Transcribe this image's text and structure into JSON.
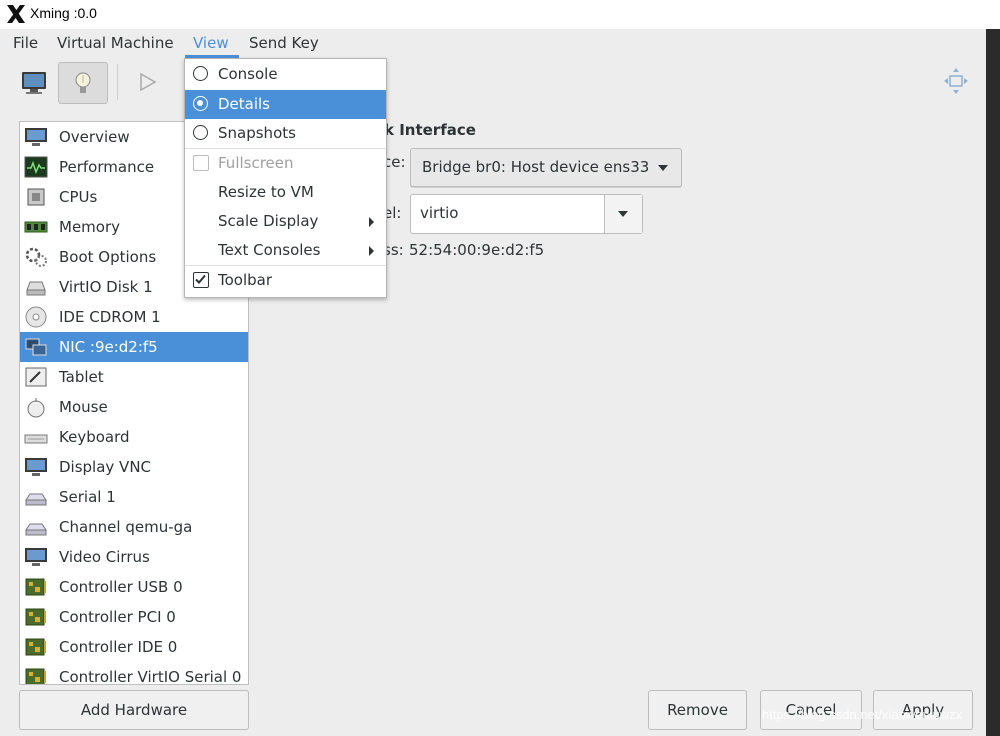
{
  "window": {
    "title": "Xming :0.0"
  },
  "menubar": {
    "file": "File",
    "virtual_machine": "Virtual Machine",
    "view": "View",
    "send_key": "Send Key"
  },
  "toolbar": {
    "buttons": [
      "monitor-icon",
      "lightbulb-icon",
      "play-icon",
      "fullscreen-move-icon"
    ],
    "selected": "lightbulb-icon"
  },
  "sidebar": {
    "items": [
      {
        "label": "Overview",
        "icon": "overview-monitor-icon"
      },
      {
        "label": "Performance",
        "icon": "performance-graph-icon"
      },
      {
        "label": "CPUs",
        "icon": "cpu-chip-icon"
      },
      {
        "label": "Memory",
        "icon": "memory-module-icon"
      },
      {
        "label": "Boot Options",
        "icon": "gears-icon"
      },
      {
        "label": "VirtIO Disk 1",
        "icon": "disk-drive-icon"
      },
      {
        "label": "IDE CDROM 1",
        "icon": "cdrom-icon"
      },
      {
        "label": "NIC :9e:d2:f5",
        "icon": "network-card-icon"
      },
      {
        "label": "Tablet",
        "icon": "tablet-icon"
      },
      {
        "label": "Mouse",
        "icon": "mouse-icon"
      },
      {
        "label": "Keyboard",
        "icon": "keyboard-icon"
      },
      {
        "label": "Display VNC",
        "icon": "display-icon"
      },
      {
        "label": "Serial 1",
        "icon": "serial-icon"
      },
      {
        "label": "Channel qemu-ga",
        "icon": "channel-icon"
      },
      {
        "label": "Video Cirrus",
        "icon": "video-icon"
      },
      {
        "label": "Controller USB 0",
        "icon": "controller-board-icon"
      },
      {
        "label": "Controller PCI 0",
        "icon": "controller-board-icon"
      },
      {
        "label": "Controller IDE 0",
        "icon": "controller-board-icon"
      },
      {
        "label": "Controller VirtIO Serial 0",
        "icon": "controller-board-icon"
      }
    ],
    "selected_index": 7
  },
  "details": {
    "heading_visible": "k Interface",
    "source_label_visible": "ce:",
    "source_value": "Bridge br0: Host device ens33",
    "model_label_visible": "el:",
    "model_value": "virtio",
    "mac_label_visible": "ss:",
    "mac_value": "52:54:00:9e:d2:f5"
  },
  "buttons": {
    "add_hardware": "Add Hardware",
    "remove": "Remove",
    "cancel": "Cancel",
    "apply": "Apply"
  },
  "view_menu": {
    "items": [
      {
        "label": "Console",
        "type": "radio",
        "checked": false
      },
      {
        "label": "Details",
        "type": "radio",
        "checked": true
      },
      {
        "label": "Snapshots",
        "type": "radio",
        "checked": false
      },
      {
        "label": "Fullscreen",
        "type": "check",
        "checked": false,
        "disabled": true
      },
      {
        "label": "Resize to VM",
        "type": "plain"
      },
      {
        "label": "Scale Display",
        "type": "submenu"
      },
      {
        "label": "Text Consoles",
        "type": "submenu"
      },
      {
        "label": "Toolbar",
        "type": "check",
        "checked": true
      }
    ]
  },
  "watermark": "https://blog.csdn.net/xiaowenluwzx",
  "colors": {
    "accent": "#4a90d9",
    "background": "#ededed",
    "sidebar_bg": "#ffffff"
  }
}
